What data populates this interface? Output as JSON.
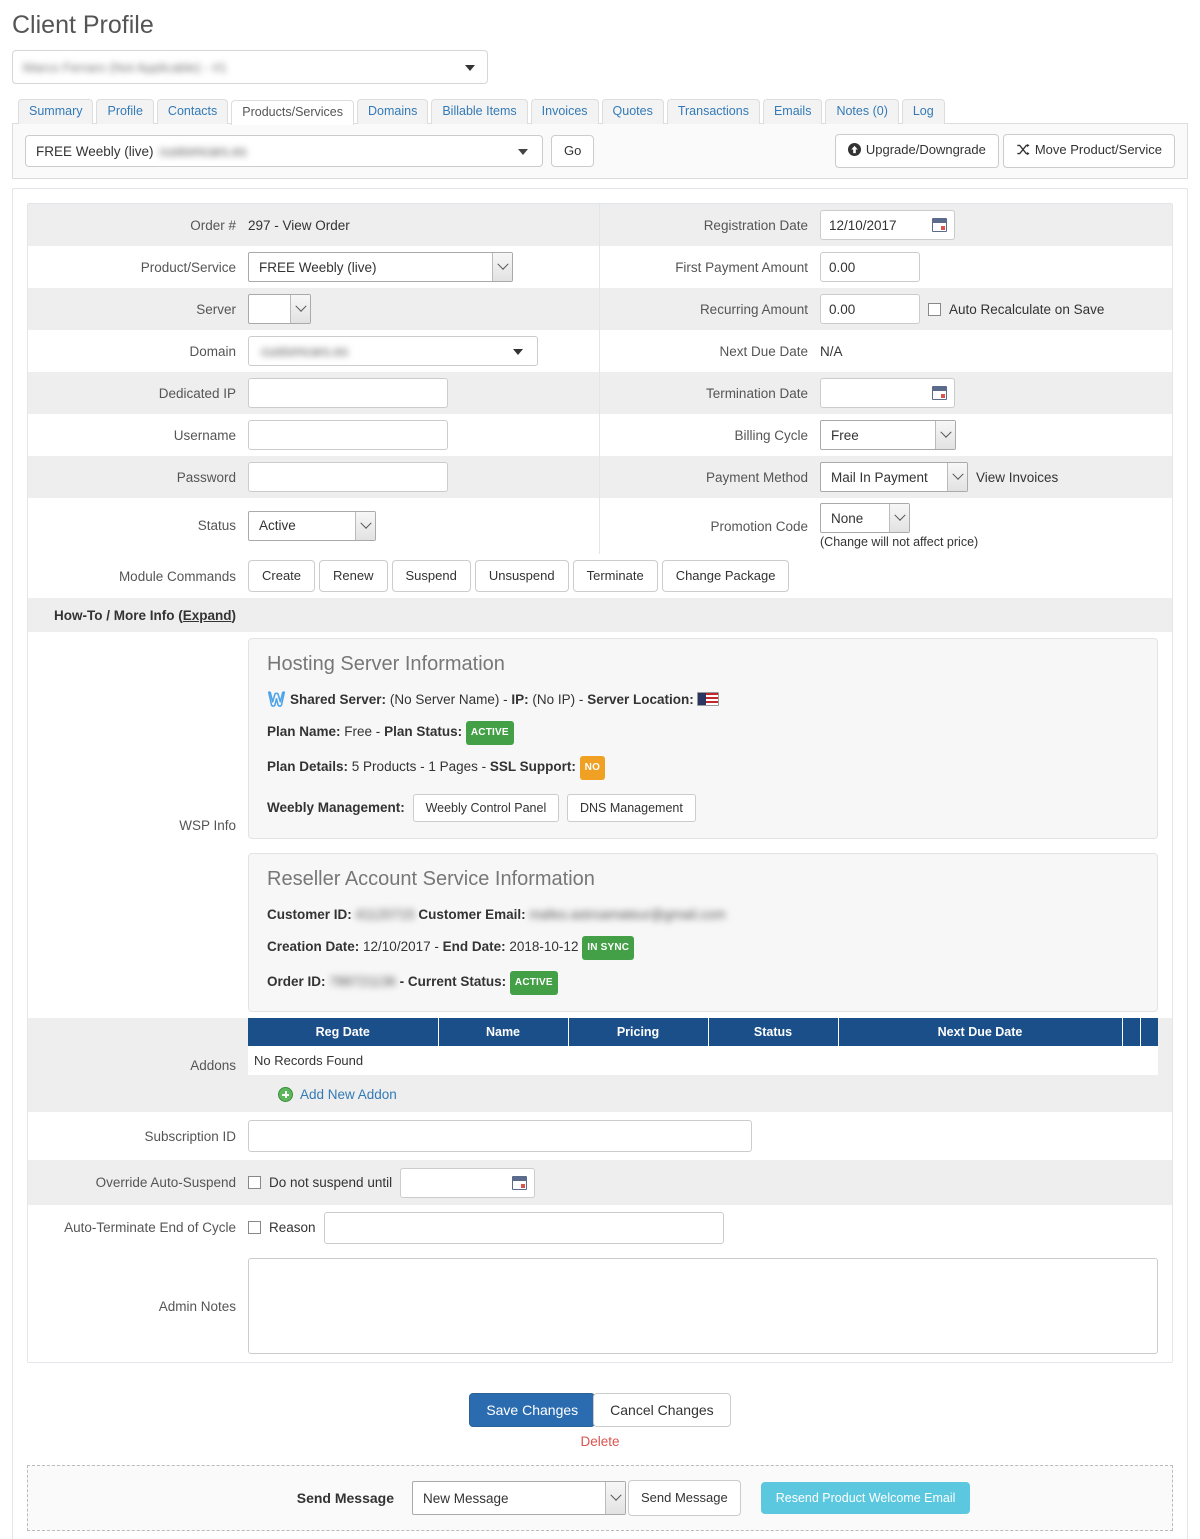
{
  "header": {
    "page_title": "Client Profile",
    "client_selector_value": "Marco Ferraro (Not Applicable) - #1",
    "client_selector_icon": "chevron-down-icon"
  },
  "tabs": [
    {
      "label": "Summary",
      "active": false
    },
    {
      "label": "Profile",
      "active": false
    },
    {
      "label": "Contacts",
      "active": false
    },
    {
      "label": "Products/Services",
      "active": true
    },
    {
      "label": "Domains",
      "active": false
    },
    {
      "label": "Billable Items",
      "active": false
    },
    {
      "label": "Invoices",
      "active": false
    },
    {
      "label": "Quotes",
      "active": false
    },
    {
      "label": "Transactions",
      "active": false
    },
    {
      "label": "Emails",
      "active": false
    },
    {
      "label": "Notes (0)",
      "active": false
    },
    {
      "label": "Log",
      "active": false
    }
  ],
  "toolbar": {
    "service_select_value": "FREE Weebly (live)",
    "service_select_domain": "customcars.es",
    "go_label": "Go",
    "upgrade_label": "Upgrade/Downgrade",
    "move_label": "Move Product/Service"
  },
  "form": {
    "left": {
      "order_label": "Order #",
      "order_value": "297 - View Order",
      "product_label": "Product/Service",
      "product_value": "FREE Weebly (live)",
      "server_label": "Server",
      "server_value": "",
      "domain_label": "Domain",
      "domain_value": "customcars.es",
      "dedicated_ip_label": "Dedicated IP",
      "dedicated_ip_value": "",
      "username_label": "Username",
      "username_value": "",
      "password_label": "Password",
      "password_value": "",
      "status_label": "Status",
      "status_value": "Active"
    },
    "right": {
      "reg_date_label": "Registration Date",
      "reg_date_value": "12/10/2017",
      "first_payment_label": "First Payment Amount",
      "first_payment_value": "0.00",
      "recurring_label": "Recurring Amount",
      "recurring_value": "0.00",
      "auto_recalc_label": "Auto Recalculate on Save",
      "next_due_label": "Next Due Date",
      "next_due_value": "N/A",
      "termination_label": "Termination Date",
      "termination_value": "",
      "billing_cycle_label": "Billing Cycle",
      "billing_cycle_value": "Free",
      "payment_method_label": "Payment Method",
      "payment_method_value": "Mail In Payment",
      "view_invoices_label": "View Invoices",
      "promo_label": "Promotion Code",
      "promo_value": "None",
      "promo_note": "(Change will not affect price)"
    }
  },
  "module_commands": {
    "label": "Module Commands",
    "buttons": [
      "Create",
      "Renew",
      "Suspend",
      "Unsuspend",
      "Terminate",
      "Change Package"
    ]
  },
  "howto": {
    "label_prefix": "How-To / More Info (",
    "expand_label": "Expand",
    "label_suffix": ")"
  },
  "wsp": {
    "label": "WSP Info",
    "hosting": {
      "title": "Hosting Server Information",
      "line1_a": "Shared Server:",
      "line1_b": "(No Server Name) -",
      "line1_c": "IP:",
      "line1_d": "(No IP) -",
      "line1_e": "Server Location:",
      "line1_flag": "us-flag-icon",
      "line2_a": "Plan Name:",
      "line2_b": "Free -",
      "line2_c": "Plan Status:",
      "line2_badge": "ACTIVE",
      "line3_a": "Plan Details:",
      "line3_b": "5 Products - 1 Pages -",
      "line3_c": "SSL Support:",
      "line3_badge": "NO",
      "line4_a": "Weebly Management:",
      "line4_btn1": "Weebly Control Panel",
      "line4_btn2": "DNS Management"
    },
    "reseller": {
      "title": "Reseller Account Service Information",
      "customer_id_label": "Customer ID:",
      "customer_id_value": "41120715",
      "customer_email_label": "Customer Email:",
      "customer_email_value": "mafeo.astroamateur@gmail.com",
      "creation_label": "Creation Date:",
      "creation_value": "12/10/2017 -",
      "end_label": "End Date:",
      "end_value": "2018-10-12",
      "sync_badge": "IN SYNC",
      "order_id_label": "Order ID:",
      "order_id_value": "788721136",
      "current_status_label": "- Current Status:",
      "status_badge": "ACTIVE"
    }
  },
  "addons": {
    "label": "Addons",
    "columns": [
      "Reg Date",
      "Name",
      "Pricing",
      "Status",
      "Next Due Date",
      "",
      ""
    ],
    "empty_text": "No Records Found",
    "add_label": "Add New Addon",
    "add_icon": "plus-circle-icon"
  },
  "lower": {
    "subscription_label": "Subscription ID",
    "subscription_value": "",
    "override_label": "Override Auto-Suspend",
    "override_cb_label": "Do not suspend until",
    "override_date_value": "",
    "autoterm_label": "Auto-Terminate End of Cycle",
    "autoterm_cb_label": "Reason",
    "autoterm_reason_value": "",
    "notes_label": "Admin Notes",
    "notes_value": ""
  },
  "footer": {
    "save_label": "Save Changes",
    "cancel_label": "Cancel Changes",
    "delete_label": "Delete",
    "send_message_label": "Send Message",
    "message_select_value": "New Message",
    "send_button_label": "Send Message",
    "resend_label": "Resend Product Welcome Email"
  },
  "colors": {
    "table_header": "#1b4f8a",
    "primary_button": "#2b6cb0",
    "badge_green": "#43a047",
    "badge_orange": "#f0a022",
    "info_button": "#5bc8e0",
    "delete_link": "#d9534f"
  }
}
